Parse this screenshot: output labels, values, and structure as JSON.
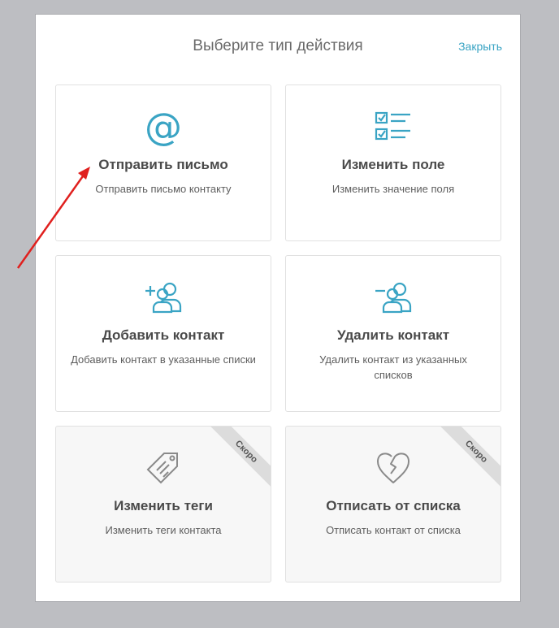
{
  "modal": {
    "title": "Выберите тип действия",
    "close_label": "Закрыть"
  },
  "cards": [
    {
      "title": "Отправить письмо",
      "desc": "Отправить письмо контакту",
      "icon": "at-icon"
    },
    {
      "title": "Изменить поле",
      "desc": "Изменить значение поля",
      "icon": "checklist-icon"
    },
    {
      "title": "Добавить контакт",
      "desc": "Добавить контакт в указанные списки",
      "icon": "add-user-icon"
    },
    {
      "title": "Удалить контакт",
      "desc": "Удалить контакт из указанных списков",
      "icon": "remove-user-icon"
    },
    {
      "title": "Изменить теги",
      "desc": "Изменить теги контакта",
      "icon": "tag-icon",
      "badge": "Скоро"
    },
    {
      "title": "Отписать от списка",
      "desc": "Отписать контакт от списка",
      "icon": "broken-heart-icon",
      "badge": "Скоро"
    }
  ],
  "colors": {
    "accent": "#3aa4c4",
    "annotation_arrow": "#e0201e",
    "disabled_icon": "#8a8a8a"
  }
}
